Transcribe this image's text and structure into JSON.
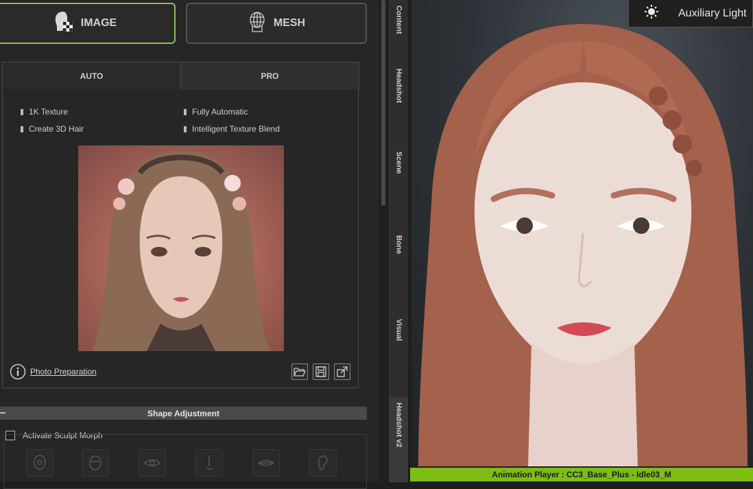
{
  "mode_buttons": {
    "image": "IMAGE",
    "mesh": "MESH"
  },
  "tabs": {
    "auto": "AUTO",
    "pro": "PRO"
  },
  "features": [
    "1K Texture",
    "Fully Automatic",
    "Create 3D Hair",
    "Intelligent Texture Blend"
  ],
  "photo_preparation": "Photo Preparation",
  "shape_adjustment": "Shape Adjustment",
  "activate_sculpt_morph": "Activate Sculpt Morph",
  "side_tabs": [
    "Content",
    "Headshot",
    "Scene",
    "Bone",
    "Visual",
    "Headshot v2"
  ],
  "auxiliary_light": "Auxiliary Light",
  "status_bar": "Animation Player : CC3_Base_Plus - Idle03_M",
  "colors": {
    "accent_green": "#7cbd16",
    "image_border": "#8bc34a"
  },
  "icons": [
    "head-image-icon",
    "mesh-head-icon",
    "info-icon",
    "folder-open-icon",
    "save-icon",
    "export-icon",
    "sun-icon"
  ]
}
